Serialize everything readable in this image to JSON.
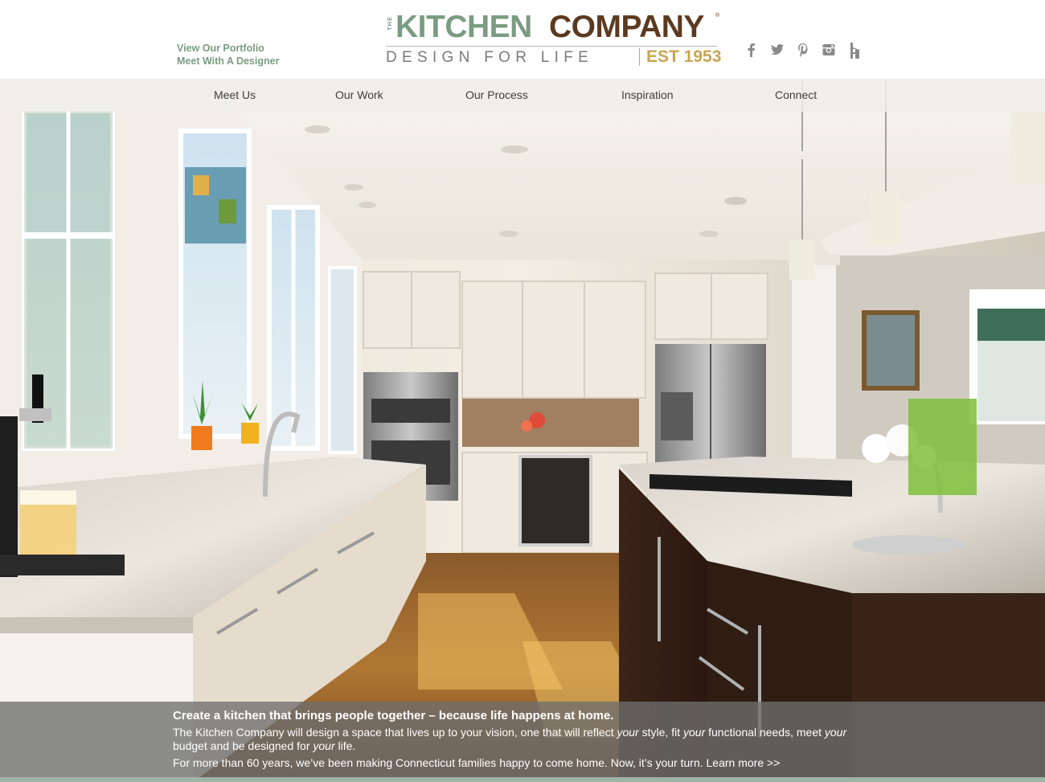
{
  "header": {
    "quick_links": [
      {
        "label": "View Our Portfolio"
      },
      {
        "label": "Meet With A Designer"
      }
    ],
    "logo": {
      "the": "THE",
      "kitchen": "KITCHEN",
      "company": "COMPANY",
      "reg": "®",
      "tagline": "DESIGN FOR LIFE",
      "est": "EST 1953"
    },
    "social": [
      "facebook-icon",
      "twitter-icon",
      "pinterest-icon",
      "instagram-icon",
      "houzz-icon"
    ]
  },
  "nav": {
    "items": [
      {
        "label": "Meet Us"
      },
      {
        "label": "Our Work"
      },
      {
        "label": "Our Process"
      },
      {
        "label": "Inspiration"
      },
      {
        "label": "Connect"
      }
    ]
  },
  "caption": {
    "headline": "Create a kitchen that brings people together – because life happens at home.",
    "body_1": "The Kitchen Company will design a space that lives up to your vision, one that will reflect",
    "em_1": "your",
    "body_2": "style, fit",
    "em_2": "your",
    "body_3": "functional needs, meet",
    "em_3": "your",
    "body_4": "budget and be designed for",
    "em_4": "your",
    "body_5": "life.",
    "body_6": "For more than 60 years, we’ve been making Connecticut families happy to come home. Now, it’s your turn.",
    "learn_more": "Learn more >>"
  },
  "colors": {
    "sage": "#7a9c82",
    "brown": "#5b3a20",
    "gold": "#c8a552",
    "caption_bg": "#6e6e6e"
  }
}
